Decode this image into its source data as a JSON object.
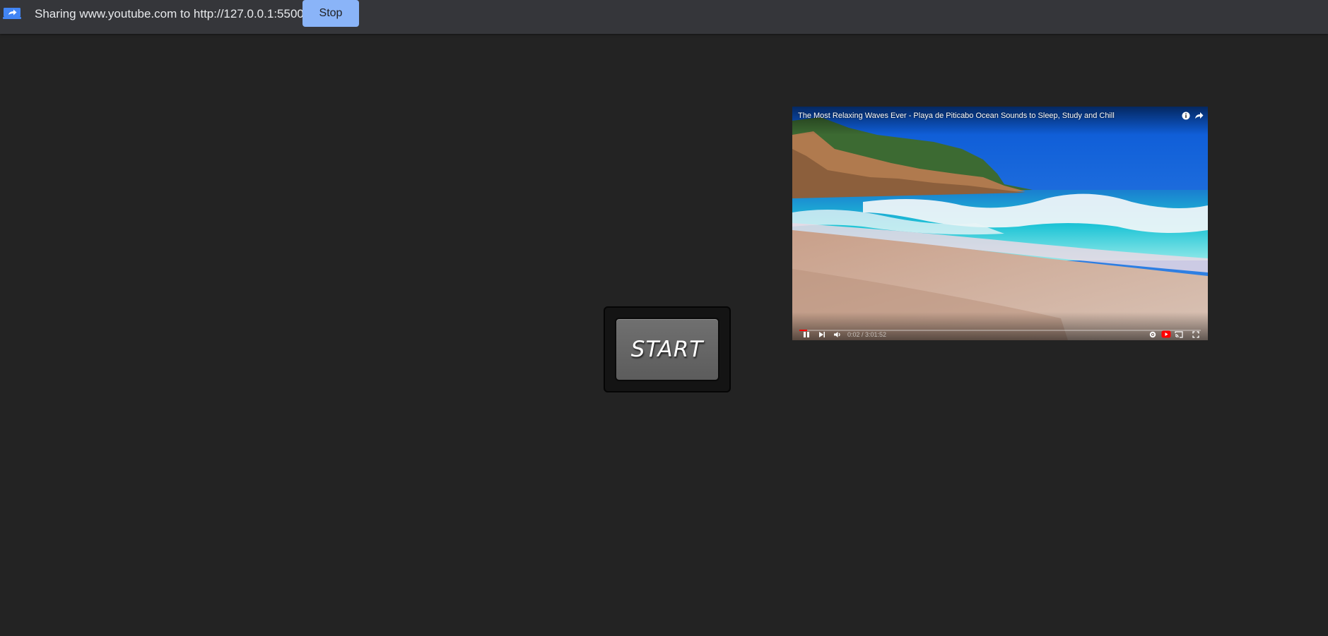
{
  "share_bar": {
    "message": "Sharing www.youtube.com to http://127.0.0.1:5500",
    "stop_label": "Stop",
    "icon": "screen-share-icon",
    "accent": "#8ab4f8"
  },
  "start_button": {
    "label": "START"
  },
  "video": {
    "title": "The Most Relaxing Waves Ever - Playa de Piticabo Ocean Sounds to Sleep, Study and Chill",
    "time": "0:02 / 3:01:52",
    "progress": 0.02,
    "top_icons": [
      "info-icon",
      "share-icon"
    ],
    "controls": [
      "pause-icon",
      "next-icon",
      "volume-icon",
      "settings-icon",
      "youtube-logo-icon",
      "cast-icon",
      "fullscreen-icon"
    ]
  }
}
